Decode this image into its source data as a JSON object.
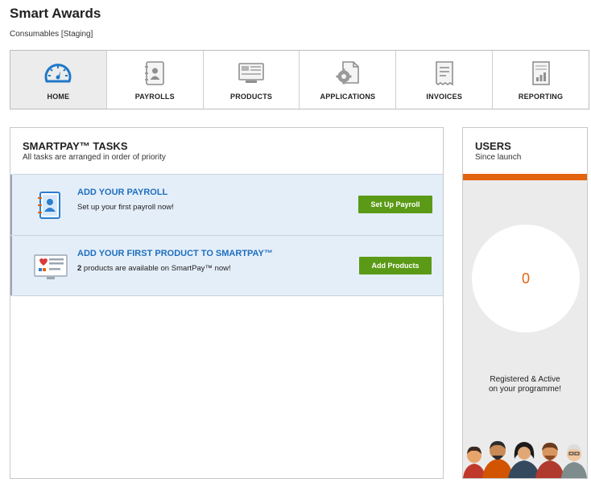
{
  "app": {
    "title": "Smart Awards",
    "subtitle": "Consumables [Staging]"
  },
  "nav": {
    "items": [
      {
        "label": "HOME",
        "icon": "dashboard-icon",
        "active": true
      },
      {
        "label": "PAYROLLS",
        "icon": "contact-book-icon",
        "active": false
      },
      {
        "label": "PRODUCTS",
        "icon": "product-screen-icon",
        "active": false
      },
      {
        "label": "APPLICATIONS",
        "icon": "gear-document-icon",
        "active": false
      },
      {
        "label": "INVOICES",
        "icon": "receipt-icon",
        "active": false
      },
      {
        "label": "REPORTING",
        "icon": "report-chart-icon",
        "active": false
      }
    ]
  },
  "tasks": {
    "title": "SMARTPAY™ TASKS",
    "subtitle": "All tasks are arranged in order of priority",
    "items": [
      {
        "title": "ADD YOUR PAYROLL",
        "description": "Set up your first payroll now!",
        "button": "Set Up Payroll",
        "icon": "payroll-book-icon"
      },
      {
        "title": "ADD YOUR FIRST PRODUCT TO SMARTPAY™",
        "count": "2",
        "description_rest": " products are available on SmartPay™ now!",
        "button": "Add Products",
        "icon": "product-list-icon"
      }
    ]
  },
  "users": {
    "title": "USERS",
    "subtitle": "Since launch",
    "count": "0",
    "caption_line1": "Registered & Active",
    "caption_line2": "on your programme!"
  },
  "colors": {
    "accent_blue": "#1f6fbf",
    "button_green": "#5b9a16",
    "orange": "#e3640f",
    "task_bg": "#e4eef9"
  }
}
